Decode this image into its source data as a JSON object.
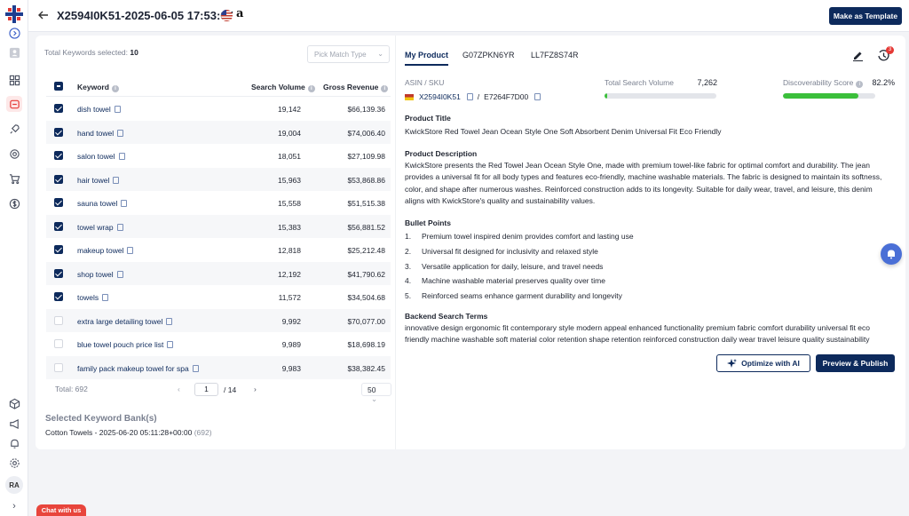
{
  "header": {
    "title": "X2594I0K51-2025-06-05 17:53:07",
    "marketplace_icon": "amazon-icon",
    "flag_icon": "us-flag-icon",
    "amazon_glyph": "a",
    "template_button": "Make as Template"
  },
  "sidebar": {
    "items": [
      "expand-icon",
      "user-icon",
      "dashboard-icon",
      "listing-icon",
      "rocket-icon",
      "settings-gear-icon",
      "cart-icon",
      "dollar-icon",
      "box-icon",
      "megaphone-icon",
      "bell-icon",
      "gear-icon"
    ],
    "avatar": "RA",
    "collapse": "›"
  },
  "keywords": {
    "total_selected_label": "Total Keywords selected:",
    "total_selected_count": "10",
    "match_type_placeholder": "Pick Match Type",
    "columns": {
      "keyword": "Keyword",
      "volume": "Search Volume",
      "revenue": "Gross Revenue"
    },
    "rows": [
      {
        "name": "dish towel",
        "volume": "19,142",
        "revenue": "$66,139.36",
        "checked": true
      },
      {
        "name": "hand towel",
        "volume": "19,004",
        "revenue": "$74,006.40",
        "checked": true
      },
      {
        "name": "salon towel",
        "volume": "18,051",
        "revenue": "$27,109.98",
        "checked": true
      },
      {
        "name": "hair towel",
        "volume": "15,963",
        "revenue": "$53,868.86",
        "checked": true
      },
      {
        "name": "sauna towel",
        "volume": "15,558",
        "revenue": "$51,515.38",
        "checked": true
      },
      {
        "name": "towel wrap",
        "volume": "15,383",
        "revenue": "$56,881.52",
        "checked": true
      },
      {
        "name": "makeup towel",
        "volume": "12,818",
        "revenue": "$25,212.48",
        "checked": true
      },
      {
        "name": "shop towel",
        "volume": "12,192",
        "revenue": "$41,790.62",
        "checked": true
      },
      {
        "name": "towels",
        "volume": "11,572",
        "revenue": "$34,504.68",
        "checked": true
      },
      {
        "name": "extra large detailing towel",
        "volume": "9,992",
        "revenue": "$70,077.00",
        "checked": false
      },
      {
        "name": "blue towel pouch price list",
        "volume": "9,989",
        "revenue": "$18,698.19",
        "checked": false
      },
      {
        "name": "family pack makeup towel for spa",
        "volume": "9,983",
        "revenue": "$38,382.45",
        "checked": false
      }
    ],
    "footer": {
      "total": "Total: 692",
      "page": "1",
      "of": "/   14",
      "prev": "‹",
      "next": "›",
      "per_page": "50",
      "per_page_chev": "⌄"
    },
    "bank_title": "Selected Keyword Bank(s)",
    "bank_name": "Cotton Towels - 2025-06-20 05:11:28+00:00",
    "bank_count": "(692)"
  },
  "product": {
    "tabs": [
      "My Product",
      "G07ZPKN6YR",
      "LL7FZ8S74R"
    ],
    "history_badge": "3",
    "asin_label": "ASIN / SKU",
    "asin": "X2594I0K51",
    "sku": "E7264F7D00",
    "asin_sep": "/",
    "total_search_label": "Total Search Volume",
    "total_search_value": "7,262",
    "total_search_fill": 0.02,
    "discoverability_label": "Discoverability Score",
    "discoverability_value": "82.2%",
    "discoverability_fill": 0.822,
    "accent_color": "#0d2a5c",
    "score_color": "#3bbf3b",
    "title_label": "Product Title",
    "title": "KwickStore Red Towel Jean Ocean Style One Soft Absorbent Denim Universal Fit Eco Friendly",
    "description_label": "Product Description",
    "description": "KwickStore presents the Red Towel Jean Ocean Style One, made with premium towel-like fabric for optimal comfort and durability. The jean provides a universal fit for all body types and features eco-friendly, machine washable materials. The fabric is designed to maintain its softness, color, and shape after numerous washes. Reinforced construction adds to its longevity. Suitable for daily wear, travel, and leisure, this denim aligns with KwickStore's quality and sustainability values.",
    "bullets_label": "Bullet Points",
    "bullets": [
      "Premium towel inspired denim provides comfort and lasting use",
      "Universal fit designed for inclusivity and relaxed style",
      "Versatile application for daily, leisure, and travel needs",
      "Machine washable material preserves quality over time",
      "Reinforced seams enhance garment durability and longevity"
    ],
    "backend_label": "Backend Search Terms",
    "backend": "innovative design ergonomic fit contemporary style modern appeal enhanced functionality premium fabric comfort durability universal fit eco friendly machine washable soft material color retention shape retention reinforced construction daily wear travel leisure quality sustainability",
    "optimize_button": "Optimize with AI",
    "publish_button": "Preview & Publish"
  },
  "chat_label": "Chat with us"
}
